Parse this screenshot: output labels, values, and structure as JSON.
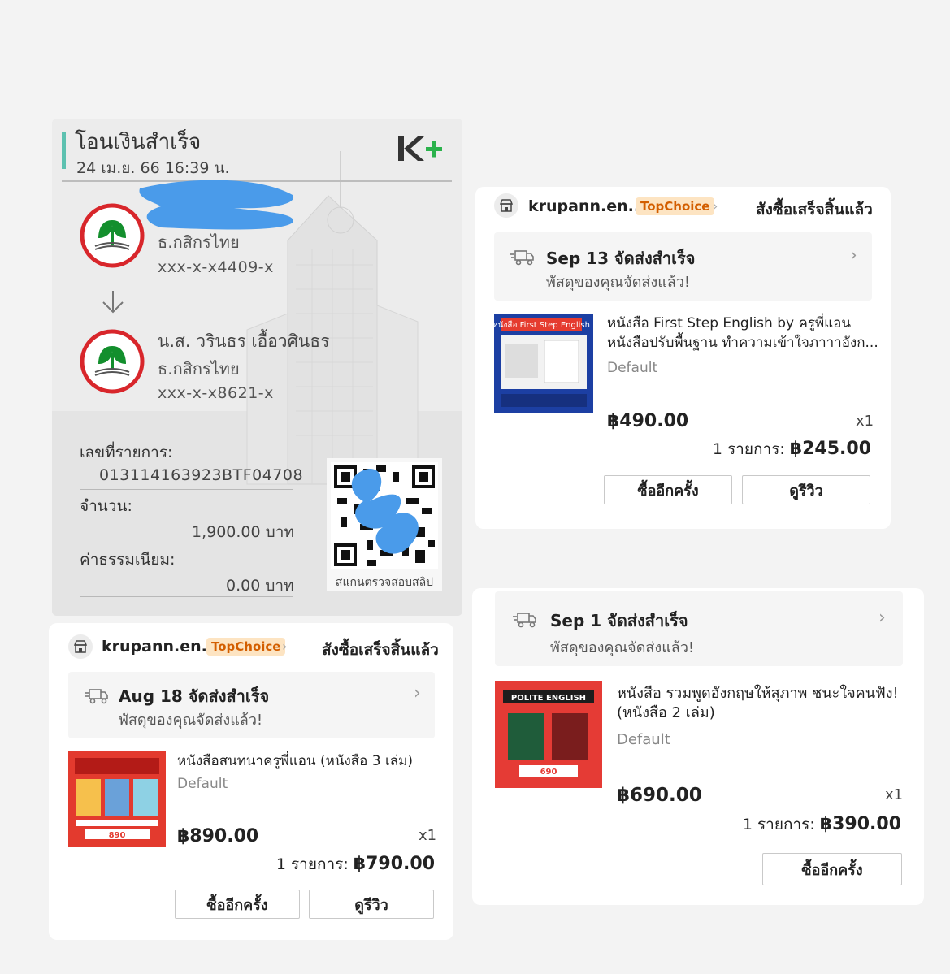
{
  "slip": {
    "title": "โอนเงินสำเร็จ",
    "datetime": "24 เม.ย. 66  16:39 น.",
    "from": {
      "bank": "ธ.กสิกรไทย",
      "account": "xxx-x-x4409-x"
    },
    "to": {
      "name": "น.ส. วรินธร เอื้อวศินธร",
      "bank": "ธ.กสิกรไทย",
      "account": "xxx-x-x8621-x"
    },
    "ref_label": "เลขที่รายการ:",
    "ref_value": "013114163923BTF04708",
    "amount_label": "จำนวน:",
    "amount_value": "1,900.00 บาท",
    "fee_label": "ค่าธรรมเนียม:",
    "fee_value": "0.00 บาท",
    "qr_caption": "สแกนตรวจสอบสลิป",
    "brand_icon": "kplus-logo",
    "colors": {
      "accent": "#5dc1b0",
      "kplus_green": "#2bb24c",
      "kbank_green": "#138f2d",
      "kbank_red": "#d8262b"
    }
  },
  "orders": [
    {
      "shop": "krupann.en...",
      "badge": "TopChoice",
      "status": "สังซื้อเสร็จสิ้นแล้ว",
      "ship_title": "Sep 13 จัดส่งสำเร็จ",
      "ship_sub": "พัสดุของคุณจัดส่งแล้ว!",
      "product_line1": "หนังสือ First Step English by ครูพี่แอน",
      "product_line2": "หนังสือปรับพื้นฐาน ทำความเข้าใจภาาาอังก...",
      "thumb_label": "หนังสือ First Step English",
      "variant": "Default",
      "price": "฿490.00",
      "qty": "x1",
      "total_label": "1 รายการ: ",
      "total_value": "฿245.00",
      "buy_again": "ซื้ออีกครั้ง",
      "review": "ดูรีวิว"
    },
    {
      "shop": "krupann.en...",
      "badge": "TopChoice",
      "status": "สังซื้อเสร็จสิ้นแล้ว",
      "ship_title": "Aug 18 จัดส่งสำเร็จ",
      "ship_sub": "พัสดุของคุณจัดส่งแล้ว!",
      "product_line1": "หนังสือสนทนาครูพี่แอน (หนังสือ 3 เล่ม)",
      "thumb_price": "890",
      "variant": "Default",
      "price": "฿890.00",
      "qty": "x1",
      "total_label": "1 รายการ: ",
      "total_value": "฿790.00",
      "buy_again": "ซื้ออีกครั้ง",
      "review": "ดูรีวิว"
    },
    {
      "ship_title": "Sep 1 จัดส่งสำเร็จ",
      "ship_sub": "พัสดุของคุณจัดส่งแล้ว!",
      "product_line1": "หนังสือ รวมพูดอังกฤษให้สุภาพ ชนะใจคนฟัง!",
      "product_line2": "(หนังสือ 2 เล่ม)",
      "thumb_label": "POLITE ENGLISH",
      "thumb_price": "690",
      "variant": "Default",
      "price": "฿690.00",
      "qty": "x1",
      "total_label": "1 รายการ: ",
      "total_value": "฿390.00",
      "buy_again": "ซื้ออีกครั้ง"
    }
  ]
}
